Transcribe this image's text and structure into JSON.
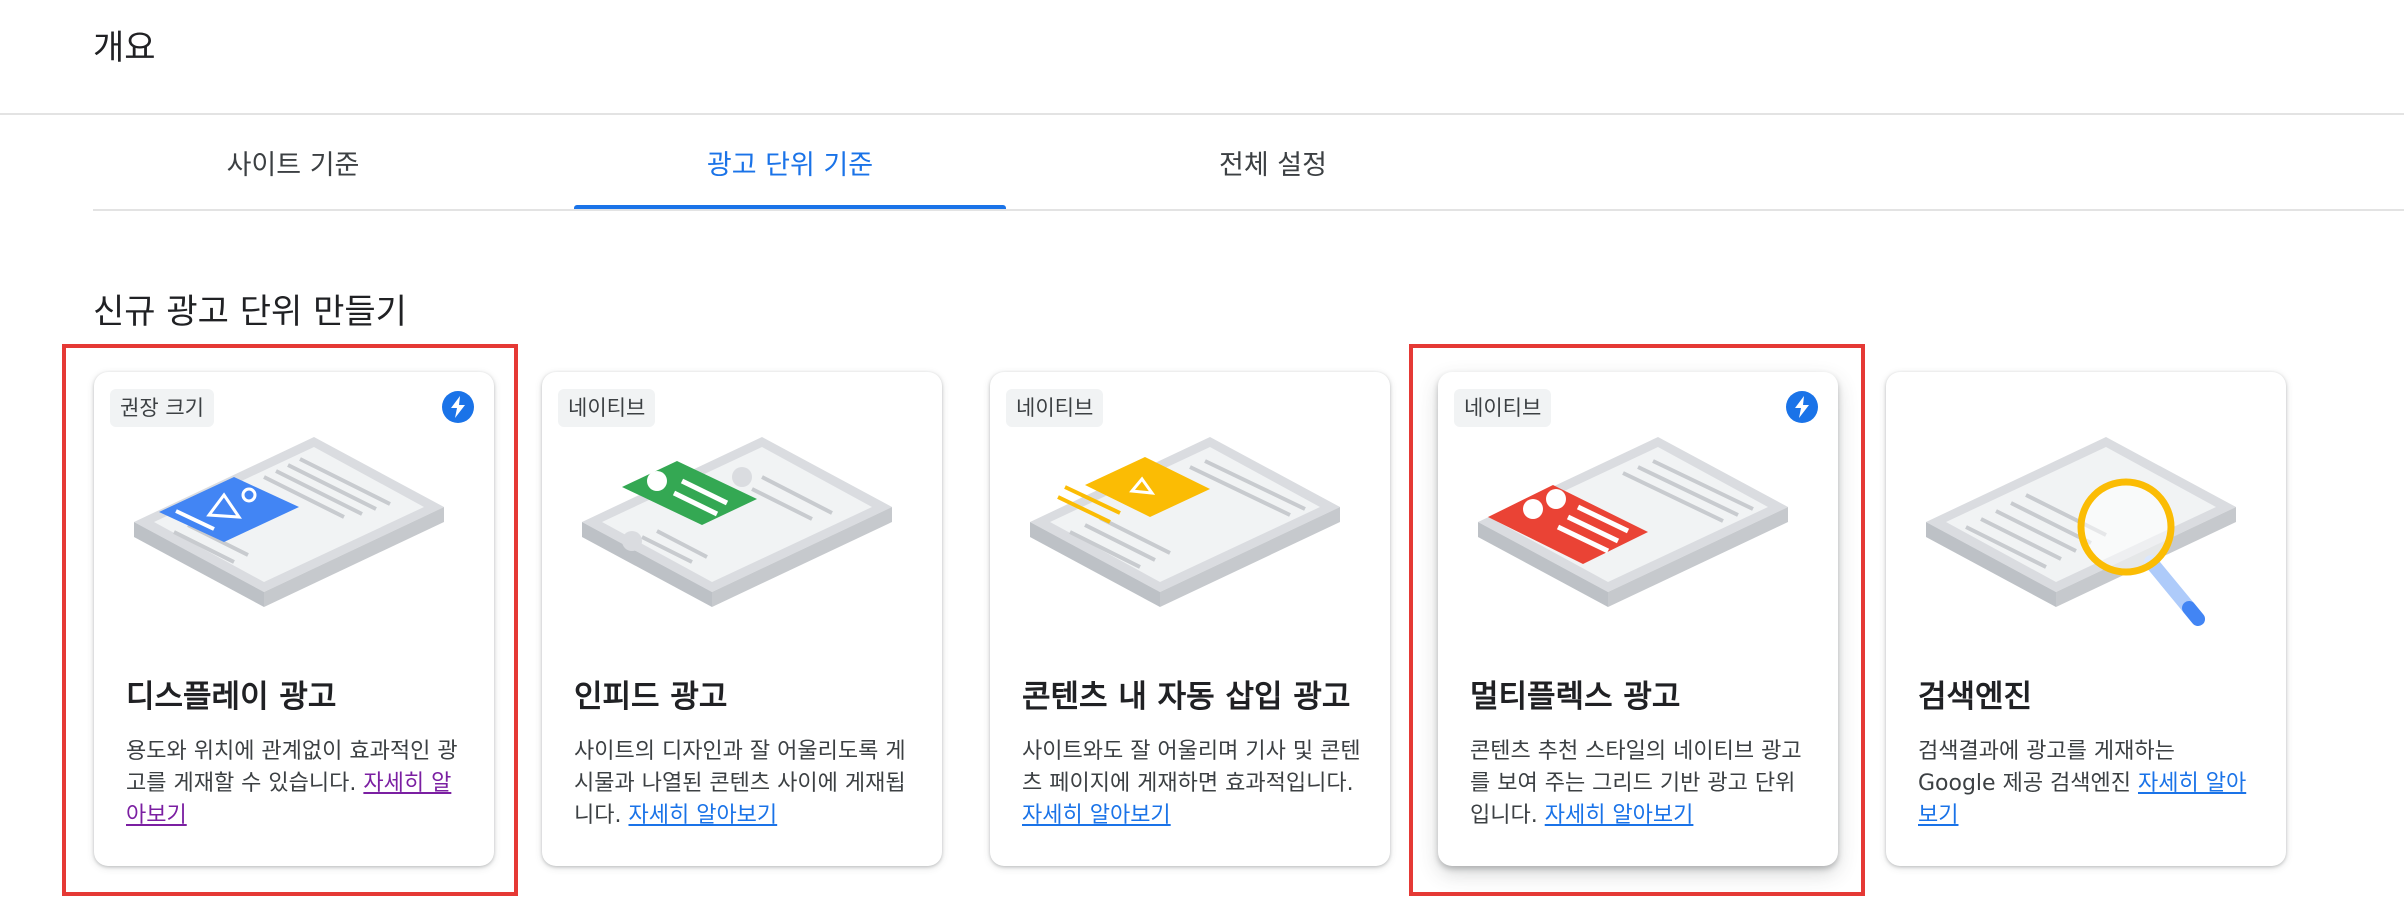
{
  "header": {
    "title": "개요"
  },
  "tabs": [
    {
      "label": "사이트 기준",
      "active": false
    },
    {
      "label": "광고 단위 기준",
      "active": true
    },
    {
      "label": "전체 설정",
      "active": false
    }
  ],
  "section": {
    "title": "신규 광고 단위 만들기"
  },
  "cards": [
    {
      "badge": "권장 크기",
      "lightning": true,
      "title": "디스플레이 광고",
      "description": "용도와 위치에 관계없이 효과적인 광고를 게재할 수 있습니다.",
      "link": "자세히 알아보기",
      "highlighted": true,
      "accent": "#4285f4"
    },
    {
      "badge": "네이티브",
      "lightning": false,
      "title": "인피드 광고",
      "description": "사이트의 디자인과 잘 어울리도록 게시물과 나열된 콘텐츠 사이에 게재됩니다.",
      "link": "자세히 알아보기",
      "highlighted": false,
      "accent": "#34a853"
    },
    {
      "badge": "네이티브",
      "lightning": false,
      "title": "콘텐츠 내 자동 삽입 광고",
      "description": "사이트와도 잘 어울리며 기사 및 콘텐츠 페이지에 게재하면 효과적입니다.",
      "link": "자세히 알아보기",
      "highlighted": false,
      "accent": "#fbbc04"
    },
    {
      "badge": "네이티브",
      "lightning": true,
      "title": "멀티플렉스 광고",
      "description": "콘텐츠 추천 스타일의 네이티브 광고를 보여 주는 그리드 기반 광고 단위입니다.",
      "link": "자세히 알아보기",
      "highlighted": true,
      "accent": "#ea4335"
    },
    {
      "badge": "",
      "lightning": false,
      "title": "검색엔진",
      "description": "검색결과에 광고를 게재하는 Google 제공 검색엔진",
      "link": "자세히 알아보기",
      "highlighted": false,
      "accent": "#fbbc04"
    }
  ],
  "icons": {
    "lightning": "lightning-bolt-icon"
  },
  "colors": {
    "accent": "#1a73e8",
    "highlight_border": "#e53935",
    "visited_link": "#7b1fa2"
  }
}
